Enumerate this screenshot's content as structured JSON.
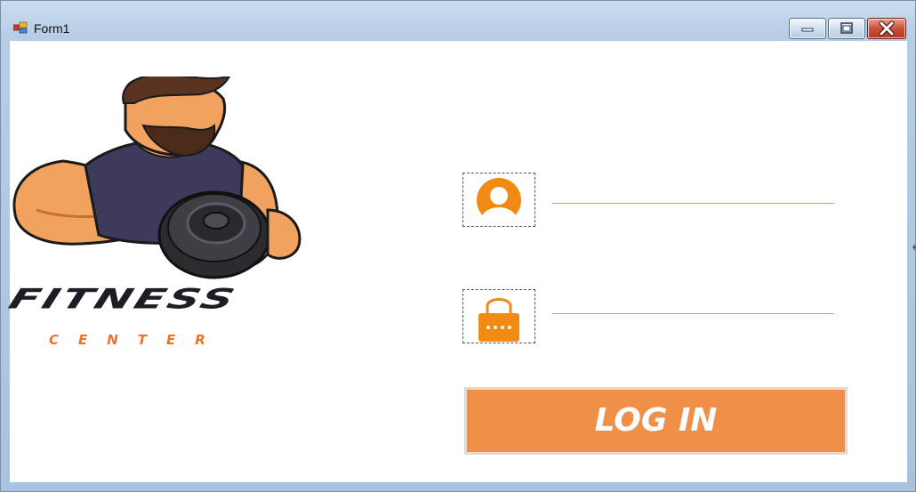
{
  "window": {
    "title": "Form1",
    "controls": {
      "minimize": "minimize-icon",
      "maximize": "maximize-icon",
      "close": "close-icon"
    }
  },
  "logo": {
    "title": "FITNESS",
    "subtitle": "CENTER",
    "image": "muscular-man-with-dumbbell"
  },
  "login_form": {
    "username_icon": "user-icon",
    "username_value": "",
    "password_icon": "lock-icon",
    "password_value": "",
    "submit_label": "LOG IN"
  },
  "colors": {
    "accent": "#ef8f48",
    "icon_orange": "#f08a12",
    "field_underline": "#e0a13a",
    "logo_dark": "#1d1d26",
    "logo_orange": "#e8762c"
  }
}
